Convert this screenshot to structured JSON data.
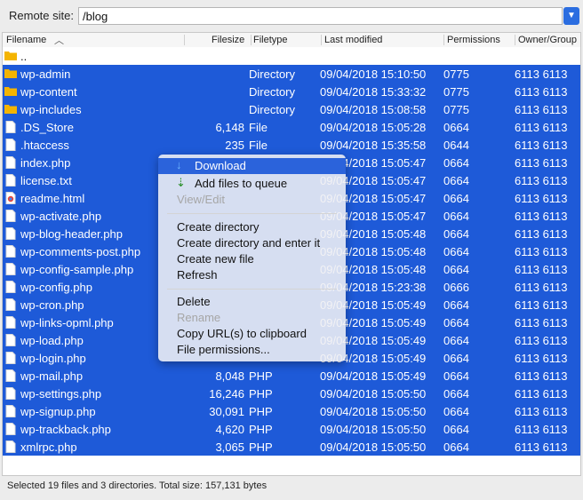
{
  "remote": {
    "label": "Remote site:",
    "path": "/blog"
  },
  "columns": {
    "filename": "Filename",
    "filesize": "Filesize",
    "filetype": "Filetype",
    "modified": "Last modified",
    "permissions": "Permissions",
    "owner": "Owner/Group"
  },
  "parent_row": {
    "name": ".."
  },
  "rows": [
    {
      "name": "wp-admin",
      "icon": "folder-icon",
      "size": "",
      "type": "Directory",
      "modified": "09/04/2018 15:10:50",
      "perm": "0775",
      "owner": "6113 6113"
    },
    {
      "name": "wp-content",
      "icon": "folder-icon",
      "size": "",
      "type": "Directory",
      "modified": "09/04/2018 15:33:32",
      "perm": "0775",
      "owner": "6113 6113"
    },
    {
      "name": "wp-includes",
      "icon": "folder-icon",
      "size": "",
      "type": "Directory",
      "modified": "09/04/2018 15:08:58",
      "perm": "0775",
      "owner": "6113 6113"
    },
    {
      "name": ".DS_Store",
      "icon": "file-icon",
      "size": "6,148",
      "type": "File",
      "modified": "09/04/2018 15:05:28",
      "perm": "0664",
      "owner": "6113 6113"
    },
    {
      "name": ".htaccess",
      "icon": "file-icon",
      "size": "235",
      "type": "File",
      "modified": "09/04/2018 15:35:58",
      "perm": "0644",
      "owner": "6113 6113"
    },
    {
      "name": "index.php",
      "icon": "file-icon",
      "size": "",
      "type": "",
      "modified": "09/04/2018 15:05:47",
      "perm": "0664",
      "owner": "6113 6113"
    },
    {
      "name": "license.txt",
      "icon": "file-icon",
      "size": "",
      "type": "",
      "modified": "09/04/2018 15:05:47",
      "perm": "0664",
      "owner": "6113 6113"
    },
    {
      "name": "readme.html",
      "icon": "browser-file-icon",
      "size": "",
      "type": "",
      "modified": "09/04/2018 15:05:47",
      "perm": "0664",
      "owner": "6113 6113"
    },
    {
      "name": "wp-activate.php",
      "icon": "file-icon",
      "size": "",
      "type": "",
      "modified": "09/04/2018 15:05:47",
      "perm": "0664",
      "owner": "6113 6113"
    },
    {
      "name": "wp-blog-header.php",
      "icon": "file-icon",
      "size": "",
      "type": "",
      "modified": "09/04/2018 15:05:48",
      "perm": "0664",
      "owner": "6113 6113"
    },
    {
      "name": "wp-comments-post.php",
      "icon": "file-icon",
      "size": "",
      "type": "",
      "modified": "09/04/2018 15:05:48",
      "perm": "0664",
      "owner": "6113 6113"
    },
    {
      "name": "wp-config-sample.php",
      "icon": "file-icon",
      "size": "",
      "type": "",
      "modified": "09/04/2018 15:05:48",
      "perm": "0664",
      "owner": "6113 6113"
    },
    {
      "name": "wp-config.php",
      "icon": "file-icon",
      "size": "",
      "type": "",
      "modified": "09/04/2018 15:23:38",
      "perm": "0666",
      "owner": "6113 6113"
    },
    {
      "name": "wp-cron.php",
      "icon": "file-icon",
      "size": "",
      "type": "",
      "modified": "09/04/2018 15:05:49",
      "perm": "0664",
      "owner": "6113 6113"
    },
    {
      "name": "wp-links-opml.php",
      "icon": "file-icon",
      "size": "",
      "type": "",
      "modified": "09/04/2018 15:05:49",
      "perm": "0664",
      "owner": "6113 6113"
    },
    {
      "name": "wp-load.php",
      "icon": "file-icon",
      "size": "",
      "type": "",
      "modified": "09/04/2018 15:05:49",
      "perm": "0664",
      "owner": "6113 6113"
    },
    {
      "name": "wp-login.php",
      "icon": "file-icon",
      "size": "",
      "type": "",
      "modified": "09/04/2018 15:05:49",
      "perm": "0664",
      "owner": "6113 6113"
    },
    {
      "name": "wp-mail.php",
      "icon": "file-icon",
      "size": "8,048",
      "type": "PHP",
      "modified": "09/04/2018 15:05:49",
      "perm": "0664",
      "owner": "6113 6113"
    },
    {
      "name": "wp-settings.php",
      "icon": "file-icon",
      "size": "16,246",
      "type": "PHP",
      "modified": "09/04/2018 15:05:50",
      "perm": "0664",
      "owner": "6113 6113"
    },
    {
      "name": "wp-signup.php",
      "icon": "file-icon",
      "size": "30,091",
      "type": "PHP",
      "modified": "09/04/2018 15:05:50",
      "perm": "0664",
      "owner": "6113 6113"
    },
    {
      "name": "wp-trackback.php",
      "icon": "file-icon",
      "size": "4,620",
      "type": "PHP",
      "modified": "09/04/2018 15:05:50",
      "perm": "0664",
      "owner": "6113 6113"
    },
    {
      "name": "xmlrpc.php",
      "icon": "file-icon",
      "size": "3,065",
      "type": "PHP",
      "modified": "09/04/2018 15:05:50",
      "perm": "0664",
      "owner": "6113 6113"
    }
  ],
  "context_menu": {
    "download": "Download",
    "add_queue": "Add files to queue",
    "view_edit": "View/Edit",
    "create_dir": "Create directory",
    "create_dir_enter": "Create directory and enter it",
    "create_file": "Create new file",
    "refresh": "Refresh",
    "delete": "Delete",
    "rename": "Rename",
    "copy_url": "Copy URL(s) to clipboard",
    "permissions": "File permissions..."
  },
  "status": "Selected 19 files and 3 directories. Total size: 157,131 bytes",
  "colors": {
    "selection": "#1e5ad8",
    "menu_highlight": "#2b63db",
    "folder": "#f4b400"
  }
}
